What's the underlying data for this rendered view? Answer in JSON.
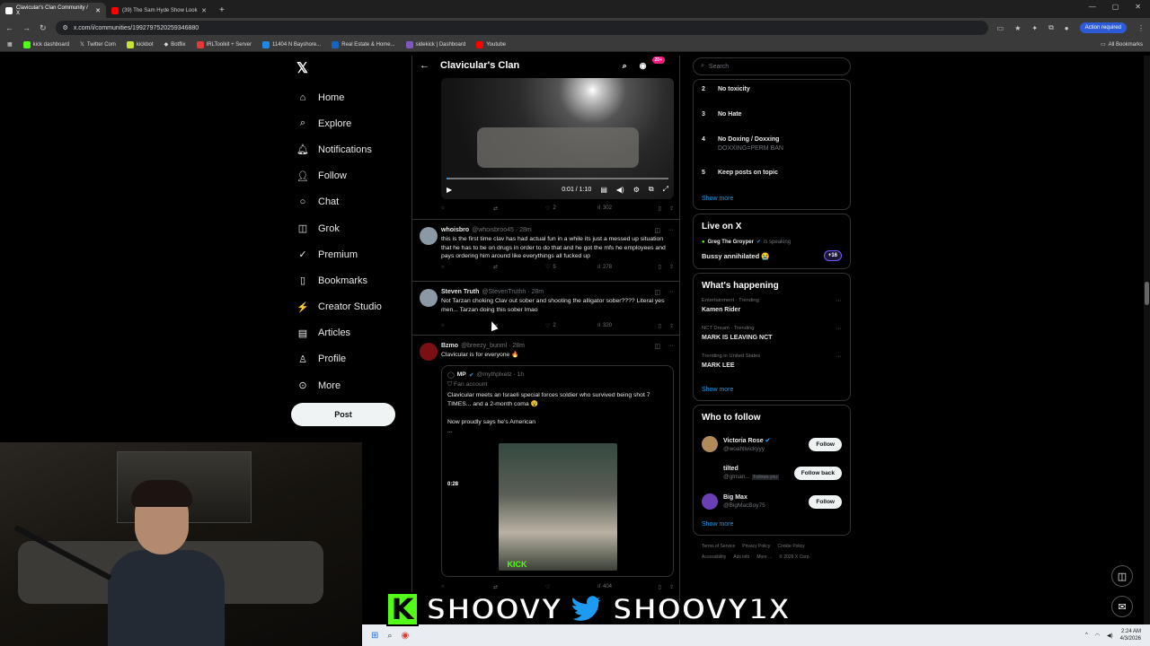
{
  "browser": {
    "tabs": [
      {
        "label": "Clavicular's Clan Community / X",
        "active": true
      },
      {
        "label": "(39) The Sam Hyde Show Look",
        "active": false
      }
    ],
    "new_tab": "+",
    "url": "x.com/i/communities/1992797520259346880",
    "action_required": "Action required",
    "bookmarks": [
      "kick dashboard",
      "Twitter Com",
      "kickbot",
      "Botflix",
      "IRLToolkit + Server",
      "11404 N Bayshore...",
      "Real Estate & Home...",
      "sidekick | Dashboard",
      "Youtube"
    ],
    "all_bookmarks": "All Bookmarks"
  },
  "nav": {
    "items": [
      "Home",
      "Explore",
      "Notifications",
      "Follow",
      "Chat",
      "Grok",
      "Premium",
      "Bookmarks",
      "Creator Studio",
      "Articles",
      "Profile",
      "More"
    ],
    "post": "Post"
  },
  "feed": {
    "title": "Clavicular's Clan",
    "badge": "20+",
    "video": {
      "time": "0:01 / 1:10",
      "progress": 0.014
    },
    "first_actions": {
      "likes": "2",
      "views": "302"
    },
    "tweets": [
      {
        "name": "whoisbro",
        "handle": "@whoisbroo45 · 28m",
        "text": "this is the first time clav has had actual fun in a while its just a messed up situation that he has to be on drugs in order to do that and he got the mfs he employees and pays ordering him around like everythings all fucked up",
        "likes": "5",
        "views": "278"
      },
      {
        "name": "Steven Truth",
        "handle": "@StevenTruthh · 28m",
        "text": "Not Tarzan choking Clav out sober and shooting the alligator sober???? Literal yes men... Tarzan doing this sober lmao",
        "likes": "2",
        "views": "320"
      },
      {
        "name": "Bzmo",
        "handle": "@breezy_bunml · 28m",
        "text": "Clavicular is for everyone 🔥",
        "likes": "",
        "views": "404"
      }
    ],
    "quote": {
      "name": "MP",
      "handle": "@mythplxelz · 1h",
      "sub": "Fan account",
      "text1": "Clavicular meets an Israeli special forces soldier who survived being shot 7 TIMES... and a 2-month coma 😵",
      "text2": "Now proudly says he's American",
      "ellipsis": "...",
      "duration": "0:28",
      "kick": "KICK"
    }
  },
  "right": {
    "search_placeholder": "Search",
    "rules": [
      {
        "n": "2",
        "title": "No toxicity",
        "sub": ""
      },
      {
        "n": "3",
        "title": "No Hate",
        "sub": ""
      },
      {
        "n": "4",
        "title": "No Doxing / Doxxing",
        "sub": "DOXXING=PERM BAN"
      },
      {
        "n": "5",
        "title": "Keep posts on topic",
        "sub": ""
      }
    ],
    "show_more": "Show more",
    "live": {
      "title": "Live on X",
      "host": "Greg The Groyper",
      "status": "is speaking",
      "text": "Bussy annihilated 😭",
      "pill": "+16"
    },
    "happening": {
      "title": "What's happening",
      "trends": [
        {
          "meta": "Entertainment · Trending",
          "name": "Kamen Rider"
        },
        {
          "meta": "NCT Dream · Trending",
          "name": "MARK IS LEAVING NCT"
        },
        {
          "meta": "Trending in United States",
          "name": "MARK LEE"
        }
      ]
    },
    "who": {
      "title": "Who to follow",
      "people": [
        {
          "name": "Victoria Rose",
          "handle": "@woahlivickyyy",
          "button": "Follow",
          "follows": ""
        },
        {
          "name": "tilted",
          "handle": "@glman...",
          "button": "Follow back",
          "follows": "Follows you"
        },
        {
          "name": "Big Max",
          "handle": "@BigMacBoy75",
          "button": "Follow",
          "follows": ""
        }
      ]
    },
    "footer": [
      "Terms of Service",
      "Privacy Policy",
      "Cookie Policy",
      "Accessibility",
      "Ads info",
      "More ...",
      "© 2026 X Corp."
    ]
  },
  "overlay": {
    "left": "SHOOVY",
    "right": "SHOOVY1X"
  },
  "taskbar": {
    "time": "2:24 AM",
    "date": "4/3/2026"
  },
  "colors": {
    "accent": "#1d9bf0",
    "kick": "#53fc18",
    "badge": "#f91880"
  }
}
